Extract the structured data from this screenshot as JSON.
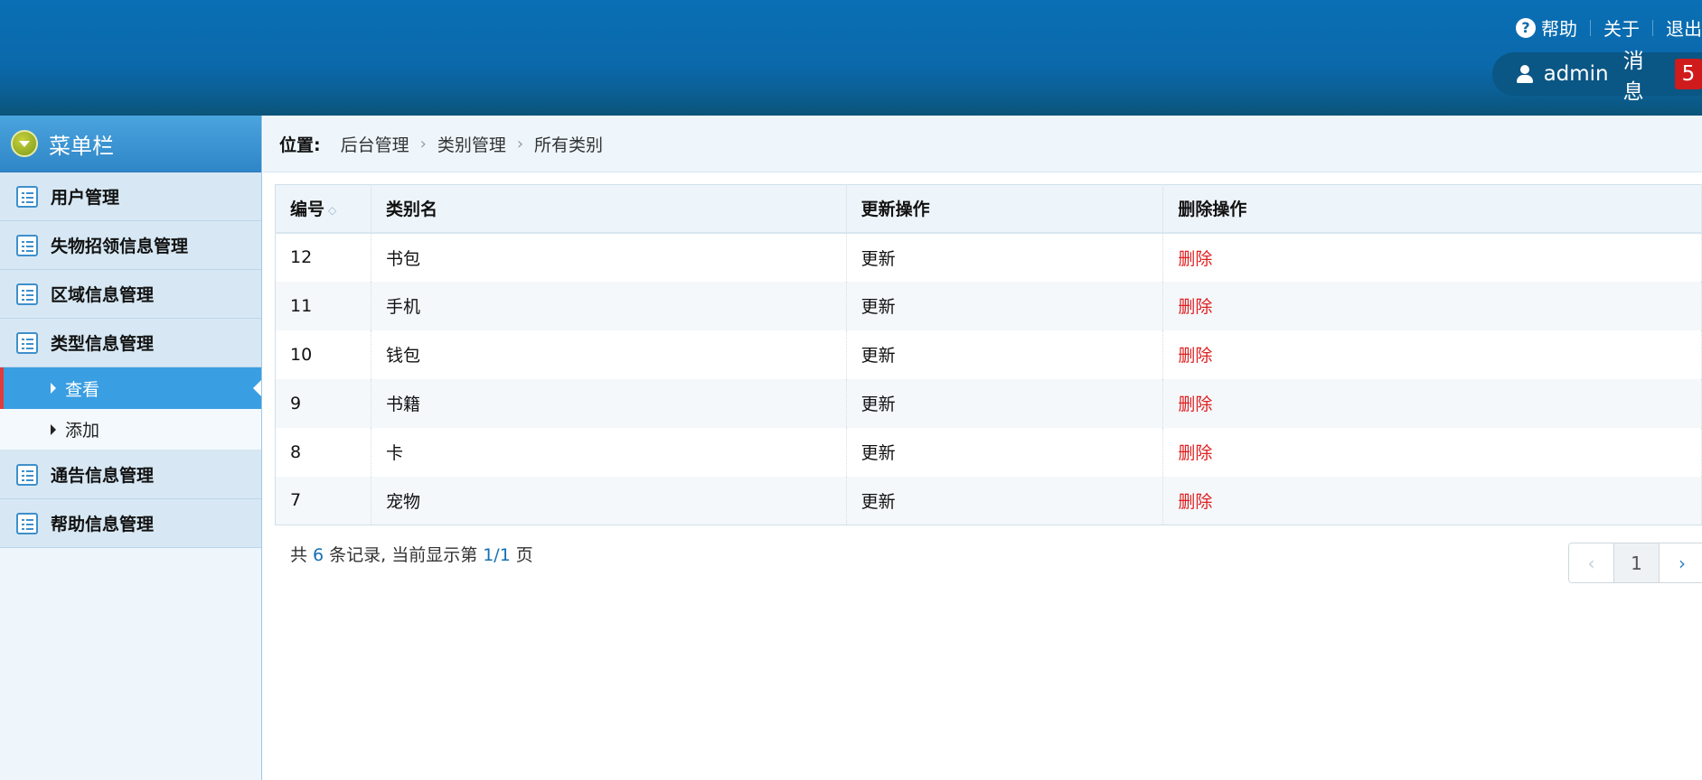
{
  "header": {
    "help": "帮助",
    "about": "关于",
    "logout": "退出",
    "username": "admin",
    "messages_label": "消息",
    "messages_count": "5"
  },
  "sidebar": {
    "title": "菜单栏",
    "groups": [
      {
        "label": "用户管理"
      },
      {
        "label": "失物招领信息管理"
      },
      {
        "label": "区域信息管理"
      },
      {
        "label": "类型信息管理",
        "children": [
          {
            "label": "查看",
            "active": true
          },
          {
            "label": "添加"
          }
        ]
      },
      {
        "label": "通告信息管理"
      },
      {
        "label": "帮助信息管理"
      }
    ]
  },
  "breadcrumb": {
    "label": "位置:",
    "items": [
      "后台管理",
      "类别管理",
      "所有类别"
    ]
  },
  "table": {
    "headers": [
      "编号",
      "类别名",
      "更新操作",
      "删除操作"
    ],
    "rows": [
      {
        "id": "12",
        "name": "书包",
        "update": "更新",
        "delete": "删除"
      },
      {
        "id": "11",
        "name": "手机",
        "update": "更新",
        "delete": "删除"
      },
      {
        "id": "10",
        "name": "钱包",
        "update": "更新",
        "delete": "删除"
      },
      {
        "id": "9",
        "name": "书籍",
        "update": "更新",
        "delete": "删除"
      },
      {
        "id": "8",
        "name": "卡",
        "update": "更新",
        "delete": "删除"
      },
      {
        "id": "7",
        "name": "宠物",
        "update": "更新",
        "delete": "删除"
      }
    ]
  },
  "paging": {
    "prefix": "共",
    "total": "6",
    "middle": "条记录, 当前显示第",
    "page": "1/1",
    "suffix": "页",
    "current": "1",
    "prev_icon": "‹",
    "next_icon": "›"
  },
  "colors": {
    "header_bg": "#0b69ab",
    "accent": "#3a9ee2",
    "delete": "#e02020",
    "badge": "#cf1b1b"
  }
}
